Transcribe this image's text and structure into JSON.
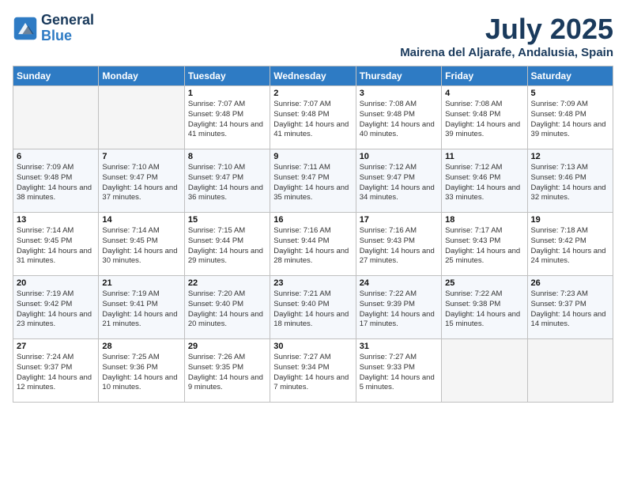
{
  "header": {
    "logo_line1": "General",
    "logo_line2": "Blue",
    "month_title": "July 2025",
    "subtitle": "Mairena del Aljarafe, Andalusia, Spain"
  },
  "weekdays": [
    "Sunday",
    "Monday",
    "Tuesday",
    "Wednesday",
    "Thursday",
    "Friday",
    "Saturday"
  ],
  "weeks": [
    [
      {
        "day": "",
        "info": ""
      },
      {
        "day": "",
        "info": ""
      },
      {
        "day": "1",
        "info": "Sunrise: 7:07 AM\nSunset: 9:48 PM\nDaylight: 14 hours and 41 minutes."
      },
      {
        "day": "2",
        "info": "Sunrise: 7:07 AM\nSunset: 9:48 PM\nDaylight: 14 hours and 41 minutes."
      },
      {
        "day": "3",
        "info": "Sunrise: 7:08 AM\nSunset: 9:48 PM\nDaylight: 14 hours and 40 minutes."
      },
      {
        "day": "4",
        "info": "Sunrise: 7:08 AM\nSunset: 9:48 PM\nDaylight: 14 hours and 39 minutes."
      },
      {
        "day": "5",
        "info": "Sunrise: 7:09 AM\nSunset: 9:48 PM\nDaylight: 14 hours and 39 minutes."
      }
    ],
    [
      {
        "day": "6",
        "info": "Sunrise: 7:09 AM\nSunset: 9:48 PM\nDaylight: 14 hours and 38 minutes."
      },
      {
        "day": "7",
        "info": "Sunrise: 7:10 AM\nSunset: 9:47 PM\nDaylight: 14 hours and 37 minutes."
      },
      {
        "day": "8",
        "info": "Sunrise: 7:10 AM\nSunset: 9:47 PM\nDaylight: 14 hours and 36 minutes."
      },
      {
        "day": "9",
        "info": "Sunrise: 7:11 AM\nSunset: 9:47 PM\nDaylight: 14 hours and 35 minutes."
      },
      {
        "day": "10",
        "info": "Sunrise: 7:12 AM\nSunset: 9:47 PM\nDaylight: 14 hours and 34 minutes."
      },
      {
        "day": "11",
        "info": "Sunrise: 7:12 AM\nSunset: 9:46 PM\nDaylight: 14 hours and 33 minutes."
      },
      {
        "day": "12",
        "info": "Sunrise: 7:13 AM\nSunset: 9:46 PM\nDaylight: 14 hours and 32 minutes."
      }
    ],
    [
      {
        "day": "13",
        "info": "Sunrise: 7:14 AM\nSunset: 9:45 PM\nDaylight: 14 hours and 31 minutes."
      },
      {
        "day": "14",
        "info": "Sunrise: 7:14 AM\nSunset: 9:45 PM\nDaylight: 14 hours and 30 minutes."
      },
      {
        "day": "15",
        "info": "Sunrise: 7:15 AM\nSunset: 9:44 PM\nDaylight: 14 hours and 29 minutes."
      },
      {
        "day": "16",
        "info": "Sunrise: 7:16 AM\nSunset: 9:44 PM\nDaylight: 14 hours and 28 minutes."
      },
      {
        "day": "17",
        "info": "Sunrise: 7:16 AM\nSunset: 9:43 PM\nDaylight: 14 hours and 27 minutes."
      },
      {
        "day": "18",
        "info": "Sunrise: 7:17 AM\nSunset: 9:43 PM\nDaylight: 14 hours and 25 minutes."
      },
      {
        "day": "19",
        "info": "Sunrise: 7:18 AM\nSunset: 9:42 PM\nDaylight: 14 hours and 24 minutes."
      }
    ],
    [
      {
        "day": "20",
        "info": "Sunrise: 7:19 AM\nSunset: 9:42 PM\nDaylight: 14 hours and 23 minutes."
      },
      {
        "day": "21",
        "info": "Sunrise: 7:19 AM\nSunset: 9:41 PM\nDaylight: 14 hours and 21 minutes."
      },
      {
        "day": "22",
        "info": "Sunrise: 7:20 AM\nSunset: 9:40 PM\nDaylight: 14 hours and 20 minutes."
      },
      {
        "day": "23",
        "info": "Sunrise: 7:21 AM\nSunset: 9:40 PM\nDaylight: 14 hours and 18 minutes."
      },
      {
        "day": "24",
        "info": "Sunrise: 7:22 AM\nSunset: 9:39 PM\nDaylight: 14 hours and 17 minutes."
      },
      {
        "day": "25",
        "info": "Sunrise: 7:22 AM\nSunset: 9:38 PM\nDaylight: 14 hours and 15 minutes."
      },
      {
        "day": "26",
        "info": "Sunrise: 7:23 AM\nSunset: 9:37 PM\nDaylight: 14 hours and 14 minutes."
      }
    ],
    [
      {
        "day": "27",
        "info": "Sunrise: 7:24 AM\nSunset: 9:37 PM\nDaylight: 14 hours and 12 minutes."
      },
      {
        "day": "28",
        "info": "Sunrise: 7:25 AM\nSunset: 9:36 PM\nDaylight: 14 hours and 10 minutes."
      },
      {
        "day": "29",
        "info": "Sunrise: 7:26 AM\nSunset: 9:35 PM\nDaylight: 14 hours and 9 minutes."
      },
      {
        "day": "30",
        "info": "Sunrise: 7:27 AM\nSunset: 9:34 PM\nDaylight: 14 hours and 7 minutes."
      },
      {
        "day": "31",
        "info": "Sunrise: 7:27 AM\nSunset: 9:33 PM\nDaylight: 14 hours and 5 minutes."
      },
      {
        "day": "",
        "info": ""
      },
      {
        "day": "",
        "info": ""
      }
    ]
  ]
}
